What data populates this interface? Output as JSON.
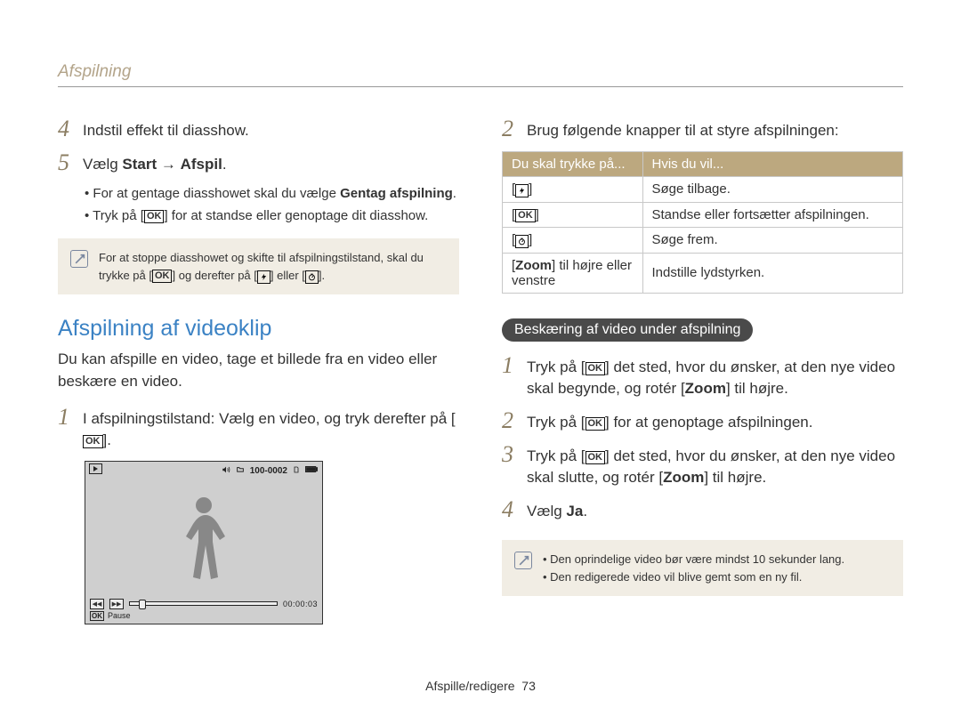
{
  "header": {
    "title": "Afspilning"
  },
  "left": {
    "step4": {
      "num": "4",
      "text": "Indstil effekt til diasshow."
    },
    "step5": {
      "num": "5",
      "prefix": "Vælg ",
      "bold1": "Start",
      "arrow": " → ",
      "bold2": "Afspil",
      "suffix": ".",
      "b1_pre": "For at gentage diasshowet skal du vælge ",
      "b1_bold": "Gentag afspilning",
      "b1_post": ".",
      "b2_pre": "Tryk på [",
      "b2_ok": "OK",
      "b2_post": "] for at standse eller genoptage dit diasshow."
    },
    "note1": {
      "l1_pre": "For at stoppe diasshowet og skifte til afspilningstilstand, skal du trykke på [",
      "l1_ok": "OK",
      "l1_post": "]",
      "l2_pre": "og derefter på [",
      "l2_mid": "] eller [",
      "l2_post": "]."
    },
    "section_title": "Afspilning af videoklip",
    "section_para": "Du kan afspille en video, tage et billede fra en video eller beskære en video.",
    "step1": {
      "num": "1",
      "text_pre": "I afspilningstilstand: Vælg en video, og tryk derefter på [",
      "ok": "OK",
      "text_post": "]."
    },
    "thumb": {
      "counter": "100-0002",
      "time": "00:00:03",
      "pause_label": "Pause",
      "ok": "OK"
    }
  },
  "right": {
    "step2": {
      "num": "2",
      "text": "Brug følgende knapper til at styre afspilningen:"
    },
    "table": {
      "h1": "Du skal trykke på...",
      "h2": "Hvis du vil...",
      "r1c2": "Søge tilbage.",
      "r2c1": "OK",
      "r2c2": "Standse eller fortsætter afspilningen.",
      "r3c2": "Søge frem.",
      "r4c1_pre": "[",
      "r4c1_bold": "Zoom",
      "r4c1_post": "] til højre eller venstre",
      "r4c2": "Indstille lydstyrken."
    },
    "pill": "Beskæring af video under afspilning",
    "cs1": {
      "num": "1",
      "pre": "Tryk på [",
      "ok": "OK",
      "mid": "] det sted, hvor du ønsker, at den nye video skal begynde, og rotér [",
      "bold": "Zoom",
      "post": "] til højre."
    },
    "cs2": {
      "num": "2",
      "pre": "Tryk på [",
      "ok": "OK",
      "post": "] for at genoptage afspilningen."
    },
    "cs3": {
      "num": "3",
      "pre": "Tryk på [",
      "ok": "OK",
      "mid": "] det sted, hvor du ønsker, at den nye video skal slutte, og rotér [",
      "bold": "Zoom",
      "post": "] til højre."
    },
    "cs4": {
      "num": "4",
      "pre": "Vælg ",
      "bold": "Ja",
      "post": "."
    },
    "note2": {
      "b1": "Den oprindelige video bør være mindst 10 sekunder lang.",
      "b2": "Den redigerede video vil blive gemt som en ny fil."
    }
  },
  "footer": {
    "label": "Afspille/redigere",
    "page": "73"
  }
}
